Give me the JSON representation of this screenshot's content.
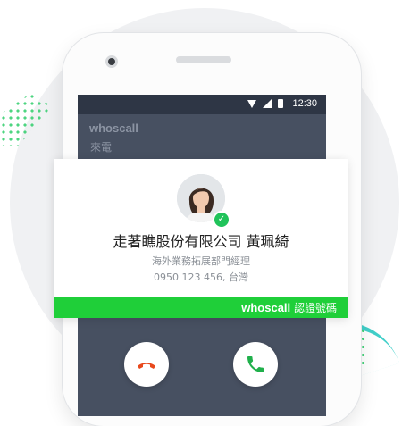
{
  "status_bar": {
    "time": "12:30"
  },
  "background_app": {
    "brand": "whoscall",
    "incoming_label": "來電"
  },
  "caller_card": {
    "name": "走著瞧股份有限公司 黃珮綺",
    "title": "海外業務拓展部門經理",
    "phone_location": "0950 123 456, 台灣",
    "verify_brand": "whoscall",
    "verify_label": "認證號碼"
  },
  "icons": {
    "wifi": "wifi-icon",
    "signal": "signal-icon",
    "battery": "battery-icon",
    "verified": "checkmark-icon",
    "decline": "hang-up-icon",
    "accept": "phone-icon"
  },
  "colors": {
    "accent_green": "#1fcf39",
    "decline_red": "#e8491d",
    "accept_green": "#20b04b",
    "screen_bg": "#475061"
  }
}
